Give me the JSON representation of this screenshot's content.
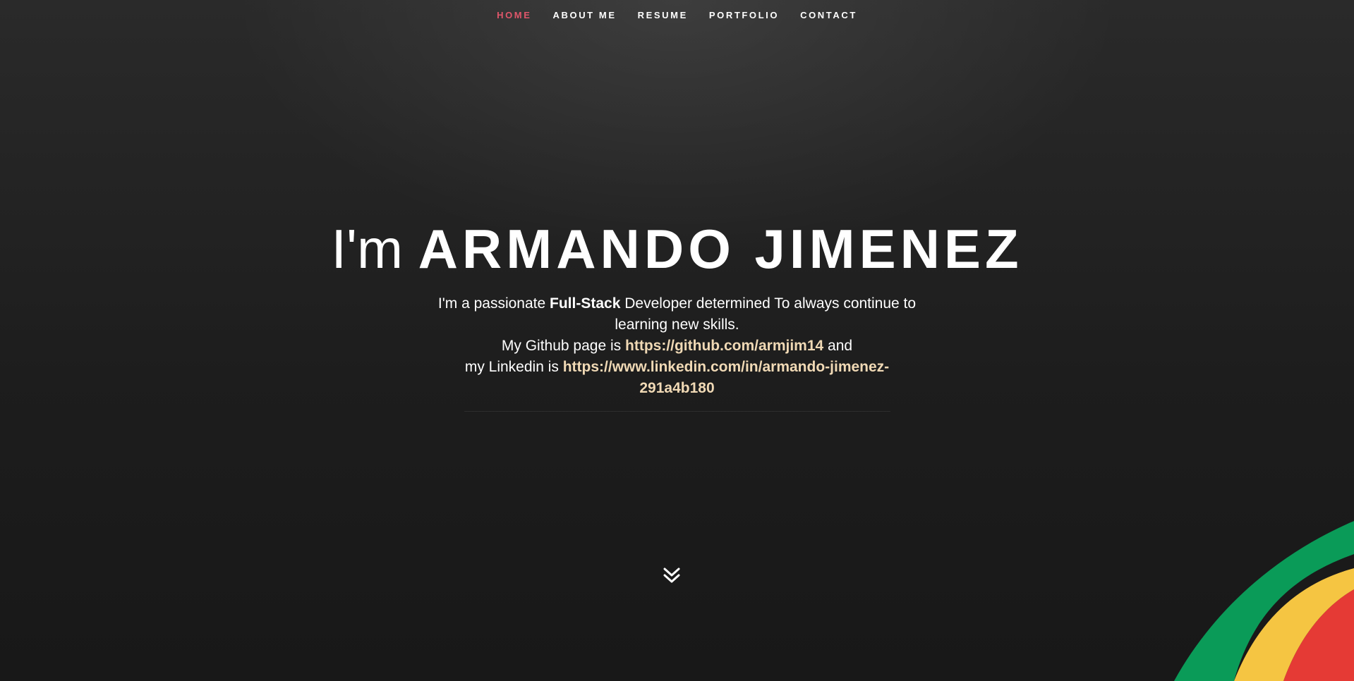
{
  "nav": {
    "items": [
      {
        "label": "HOME",
        "active": true
      },
      {
        "label": "ABOUT ME",
        "active": false
      },
      {
        "label": "RESUME",
        "active": false
      },
      {
        "label": "PORTFOLIO",
        "active": false
      },
      {
        "label": "CONTACT",
        "active": false
      }
    ],
    "active_color": "#e0566a"
  },
  "headline": {
    "prefix": "I'm",
    "name": "ARMANDO JIMENEZ"
  },
  "description": {
    "intro_before": "I'm a passionate",
    "intro_bold": "Full-Stack",
    "intro_after": "Developer determined To always continue to learning new skills.",
    "github_before": "My Github page is",
    "github_link": "https://github.com/armjim14",
    "github_after": "and",
    "linkedin_before": "my Linkedin is",
    "linkedin_link": "https://www.linkedin.com/in/armando-jimenez-291a4b180"
  },
  "icons": {
    "scroll": "double-chevron-down-icon",
    "decoration": "tricolor-stripes"
  },
  "colors": {
    "background": "#1c1c1c",
    "link": "#f0d9b5",
    "stripe_green": "#0a9b58",
    "stripe_yellow": "#f5c542",
    "stripe_red": "#e53a35"
  }
}
